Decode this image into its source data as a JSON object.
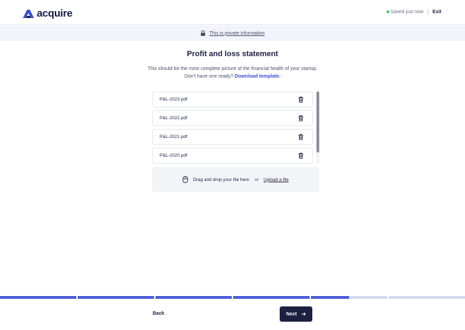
{
  "brand": {
    "name": "acquire",
    "color": "#3b4fd8",
    "dark": "#1a1f4d"
  },
  "header": {
    "status_text": "Saved just now",
    "status_color": "#3ec46d",
    "exit_label": "Exit"
  },
  "privacy": {
    "icon": "lock-icon",
    "text": "This is private information"
  },
  "main": {
    "title": "Profit and loss statement",
    "subtitle_line1": "This should be the most complete picture of the financial health of your startup.",
    "subtitle_line2": "Don't have one ready?",
    "download_link": "Download template."
  },
  "files": [
    {
      "name": "P&L-2023.pdf",
      "action_icon": "trash-icon"
    },
    {
      "name": "P&L-2022.pdf",
      "action_icon": "trash-icon"
    },
    {
      "name": "P&L-2021.pdf",
      "action_icon": "trash-icon"
    },
    {
      "name": "P&L-2020.pdf",
      "action_icon": "trash-icon"
    }
  ],
  "dropzone": {
    "icon": "mouse-icon",
    "drag_text": "Drag and drop your file here",
    "or_text": "or",
    "upload_link": "Upload a file"
  },
  "progress": {
    "completed_steps": 4.5,
    "total_steps": 6,
    "active_color": "#4a5bd6",
    "inactive_color": "#d3dbee"
  },
  "footer": {
    "back_label": "Back",
    "next_label": "Next",
    "next_icon": "arrow-right-icon"
  }
}
